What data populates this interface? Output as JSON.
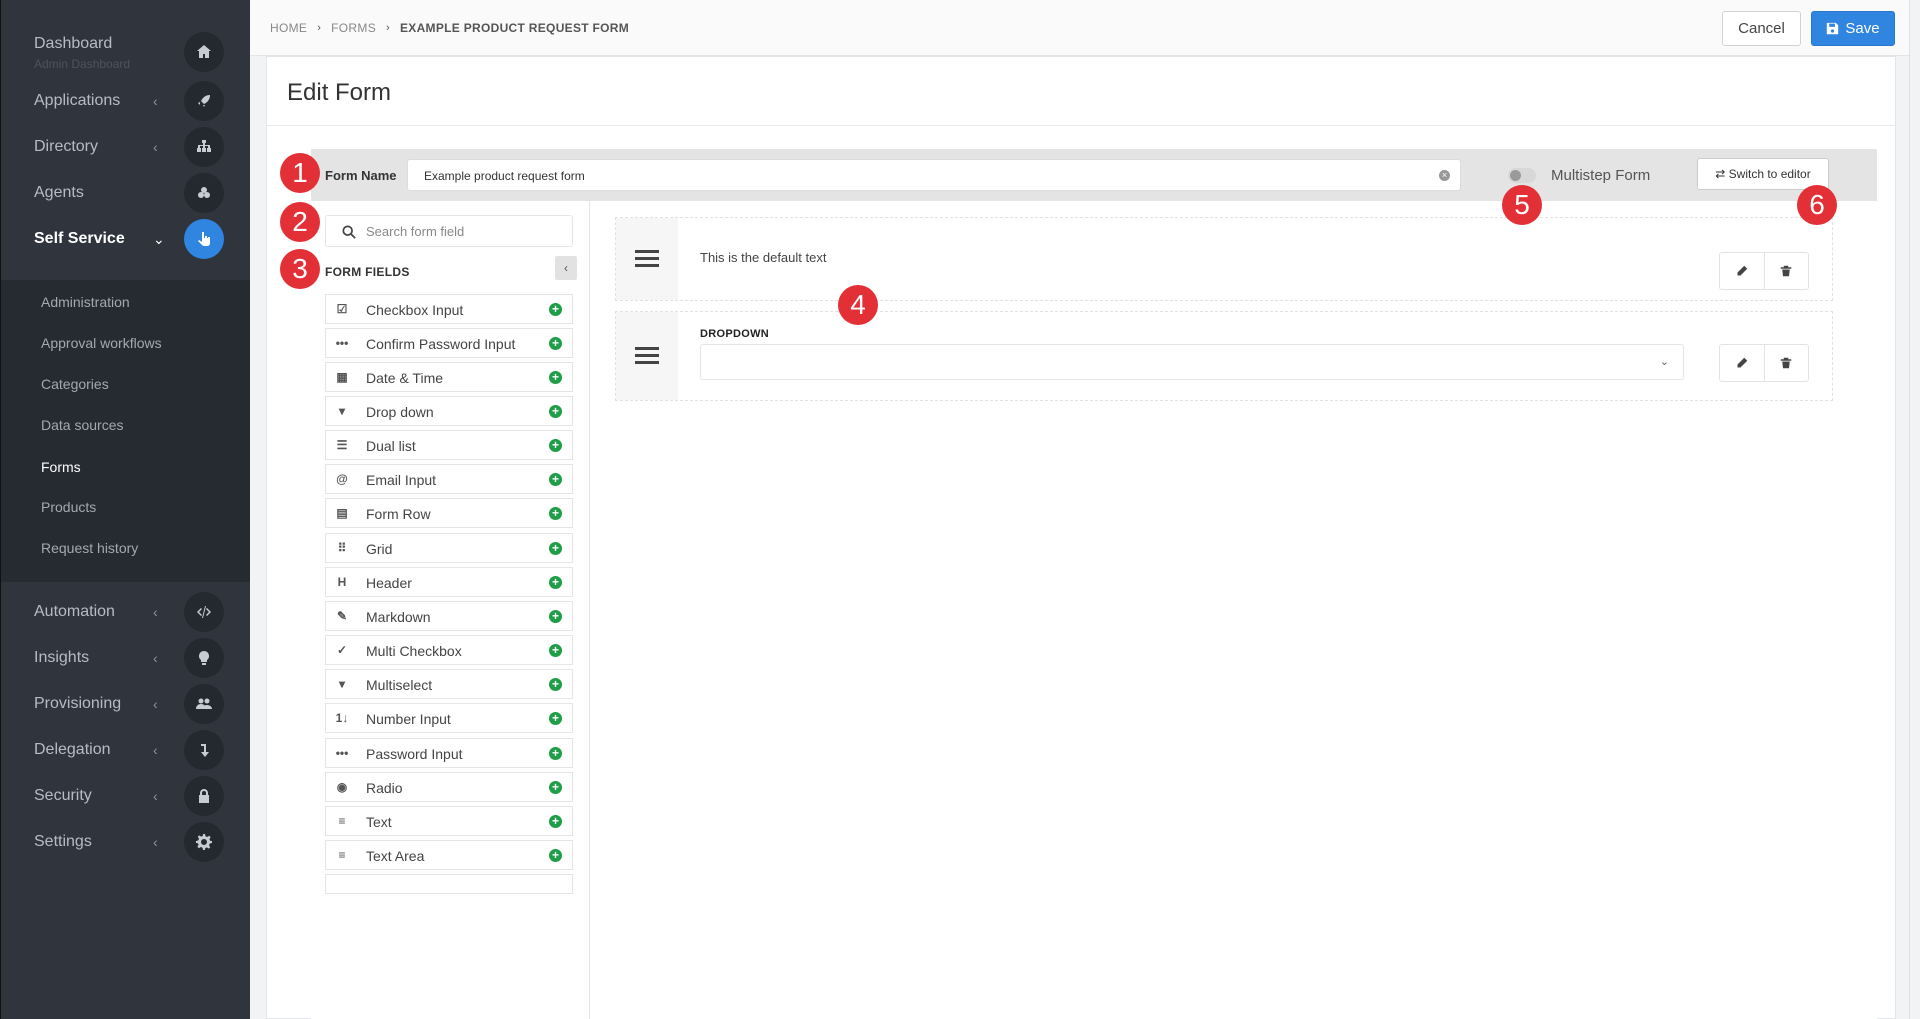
{
  "sidebar": {
    "items": [
      {
        "label": "Dashboard",
        "sub": "Admin Dashboard",
        "icon": "home-icon"
      },
      {
        "label": "Applications",
        "icon": "rocket-icon"
      },
      {
        "label": "Directory",
        "icon": "sitemap-icon"
      },
      {
        "label": "Agents",
        "icon": "cubes-icon"
      },
      {
        "label": "Self Service",
        "icon": "hand-pointer-icon"
      },
      {
        "label": "Automation",
        "icon": "code-icon"
      },
      {
        "label": "Insights",
        "icon": "lightbulb-icon"
      },
      {
        "label": "Provisioning",
        "icon": "users-icon"
      },
      {
        "label": "Delegation",
        "icon": "level-down-icon"
      },
      {
        "label": "Security",
        "icon": "lock-icon"
      },
      {
        "label": "Settings",
        "icon": "gear-icon"
      }
    ],
    "submenu": [
      "Administration",
      "Approval workflows",
      "Categories",
      "Data sources",
      "Forms",
      "Products",
      "Request history"
    ]
  },
  "breadcrumb": [
    "HOME",
    "FORMS",
    "EXAMPLE PRODUCT REQUEST FORM"
  ],
  "header": {
    "cancel_label": "Cancel",
    "save_label": "Save"
  },
  "page_title": "Edit Form",
  "form_name": {
    "label": "Form Name",
    "value": "Example product request form"
  },
  "multistep": {
    "label": "Multistep Form",
    "enabled": false
  },
  "switch_label": "Switch to editor",
  "search": {
    "placeholder": "Search form field"
  },
  "form_fields": {
    "title": "FORM FIELDS",
    "items": [
      {
        "label": "Checkbox Input",
        "icon": "☑"
      },
      {
        "label": "Confirm Password Input",
        "icon": "•••"
      },
      {
        "label": "Date & Time",
        "icon": "▦"
      },
      {
        "label": "Drop down",
        "icon": "▾"
      },
      {
        "label": "Dual list",
        "icon": "☰"
      },
      {
        "label": "Email Input",
        "icon": "@"
      },
      {
        "label": "Form Row",
        "icon": "▤"
      },
      {
        "label": "Grid",
        "icon": "⠿"
      },
      {
        "label": "Header",
        "icon": "H"
      },
      {
        "label": "Markdown",
        "icon": "✎"
      },
      {
        "label": "Multi Checkbox",
        "icon": "✓"
      },
      {
        "label": "Multiselect",
        "icon": "▾"
      },
      {
        "label": "Number Input",
        "icon": "1↓"
      },
      {
        "label": "Password Input",
        "icon": "•••"
      },
      {
        "label": "Radio",
        "icon": "◉"
      },
      {
        "label": "Text",
        "icon": "≡"
      },
      {
        "label": "Text Area",
        "icon": "≡"
      }
    ]
  },
  "canvas": {
    "rows": [
      {
        "type": "text",
        "text": "This is the default text"
      },
      {
        "type": "dropdown",
        "label": "DROPDOWN"
      }
    ]
  },
  "markers": [
    "1",
    "2",
    "3",
    "4",
    "5",
    "6"
  ]
}
